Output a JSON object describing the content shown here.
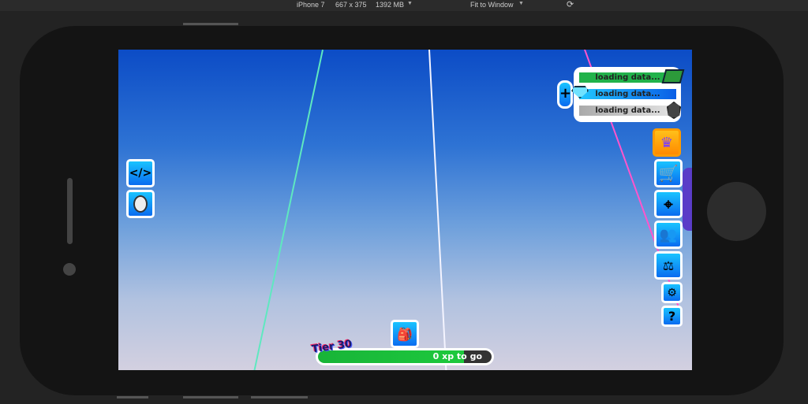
{
  "toolbar": {
    "device": "iPhone 7",
    "resolution": "667 x 375",
    "memory": "1392 MB",
    "fit": "Fit to Window"
  },
  "hud": {
    "currency": [
      {
        "label": "loading data...",
        "icon": "cash-icon"
      },
      {
        "label": "loading data...",
        "icon": "gem-icon"
      },
      {
        "label": "loading data...",
        "icon": "shard-icon"
      }
    ],
    "plus": "+",
    "tier": "Tier 30",
    "xp": "0 xp to go",
    "xp_progress": 0.84,
    "help": "?",
    "code_icon": "</>"
  },
  "colors": {
    "accent": "#0a8cf5",
    "crown_bg": "#ff9b00"
  }
}
